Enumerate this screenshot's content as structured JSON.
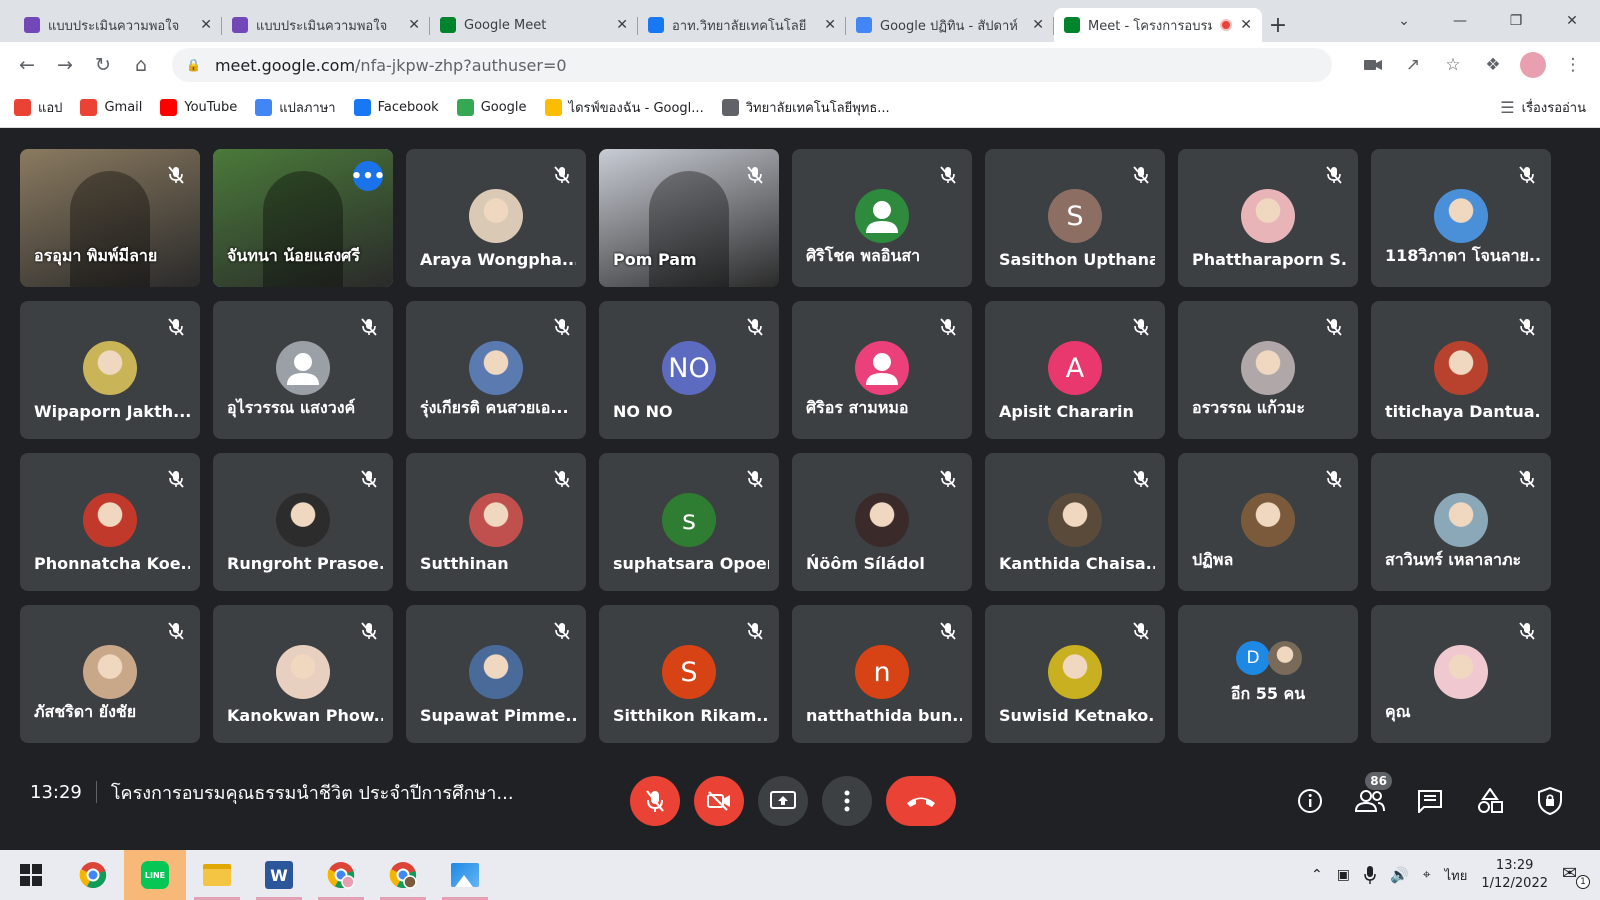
{
  "browser": {
    "tabs": [
      {
        "title": "แบบประเมินความพอใจ",
        "icon": "google-forms-icon",
        "color": "#7248b9"
      },
      {
        "title": "แบบประเมินความพอใจ",
        "icon": "google-forms-icon",
        "color": "#7248b9"
      },
      {
        "title": "Google Meet",
        "icon": "google-meet-icon",
        "color": "#00832d"
      },
      {
        "title": "อาท.วิทยาลัยเทคโนโลยี",
        "icon": "facebook-icon",
        "color": "#1877f2"
      },
      {
        "title": "Google ปฏิทิน - สัปดาห์",
        "icon": "google-calendar-icon",
        "color": "#4285f4"
      },
      {
        "title": "Meet - โครงการอบรม",
        "icon": "google-meet-icon",
        "color": "#00832d"
      }
    ],
    "new_tab": "+",
    "url_host": "meet.google.com",
    "url_path": "/nfa-jkpw-zhp?authuser=0",
    "bookmarks": [
      {
        "label": "แอป",
        "color": "#ea4335"
      },
      {
        "label": "Gmail",
        "color": "#ea4335"
      },
      {
        "label": "YouTube",
        "color": "#ff0000"
      },
      {
        "label": "แปลภาษา",
        "color": "#4285f4"
      },
      {
        "label": "Facebook",
        "color": "#1877f2"
      },
      {
        "label": "Google",
        "color": "#34a853"
      },
      {
        "label": "ไดรฟ์ของฉัน - Googl...",
        "color": "#fbbc04"
      },
      {
        "label": "วิทยาลัยเทคโนโลยีพุทธ...",
        "color": "#5f6368"
      }
    ],
    "reading_list": "เรื่องรออ่าน"
  },
  "meet": {
    "participants": [
      {
        "name": "อรอุมา พิมพ์มีลาย",
        "type": "video",
        "bg": "#8a7a60"
      },
      {
        "name": "จันทนา น้อยแสงศรี",
        "type": "video",
        "bg": "#4a7a3a",
        "speaking": true
      },
      {
        "name": "Araya Wongpha...",
        "type": "photo",
        "bg": "#d9c9b5"
      },
      {
        "name": "Pom Pam",
        "type": "video",
        "bg": "#c8ccd4"
      },
      {
        "name": "ศิริโชค พลอินสา",
        "type": "default",
        "bg": "#2e8b3e"
      },
      {
        "name": "Sasithon Upthana",
        "type": "initial",
        "initial": "S",
        "bg": "#8d6e63"
      },
      {
        "name": "Phattharaporn S...",
        "type": "photo",
        "bg": "#e8b4b8"
      },
      {
        "name": "118วิภาดา โจนลาย...",
        "type": "photo",
        "bg": "#4a90d9"
      },
      {
        "name": "Wipaporn Jakth...",
        "type": "photo",
        "bg": "#c9b458"
      },
      {
        "name": "อุไรวรรณ แสงวงค์",
        "type": "default",
        "bg": "#9aa0a6"
      },
      {
        "name": "รุ่งเกียรติ คนสวยเอ...",
        "type": "photo",
        "bg": "#5a7ab0"
      },
      {
        "name": "NO NO",
        "type": "initial",
        "initial": "NO",
        "bg": "#5c6bc0"
      },
      {
        "name": "ศิริอร สามหมอ",
        "type": "default",
        "bg": "#ec407a"
      },
      {
        "name": "Apisit Chararin",
        "type": "initial",
        "initial": "A",
        "bg": "#e8386e"
      },
      {
        "name": "อรวรรณ แก้วมะ",
        "type": "photo",
        "bg": "#b0a8a8"
      },
      {
        "name": "titichaya Dantua...",
        "type": "photo",
        "bg": "#b8422e"
      },
      {
        "name": "Phonnatcha Koe...",
        "type": "photo",
        "bg": "#c0392b"
      },
      {
        "name": "Rungroht Prasoe...",
        "type": "photo",
        "bg": "#2c2c2c"
      },
      {
        "name": "Sutthinan",
        "type": "photo",
        "bg": "#c0504d"
      },
      {
        "name": "suphatsara Opoer",
        "type": "initial",
        "initial": "s",
        "bg": "#2e7d32"
      },
      {
        "name": "Ńöôm Síládol",
        "type": "photo",
        "bg": "#3a2a2a"
      },
      {
        "name": "Kanthida Chaisa...",
        "type": "photo",
        "bg": "#5a4a3a"
      },
      {
        "name": "ปฏิพล",
        "type": "photo",
        "bg": "#7a5a3a"
      },
      {
        "name": "สาวินทร์ เหลาลาภะ",
        "type": "photo",
        "bg": "#8aa8b8"
      },
      {
        "name": "ภัสชริดา ยังชัย",
        "type": "photo",
        "bg": "#c9a88a"
      },
      {
        "name": "Kanokwan Phow...",
        "type": "photo",
        "bg": "#e8d0c0"
      },
      {
        "name": "Supawat Pimme...",
        "type": "photo",
        "bg": "#4a6a9a"
      },
      {
        "name": "Sitthikon Rikam...",
        "type": "initial",
        "initial": "S",
        "bg": "#d84315"
      },
      {
        "name": "natthathida bun...",
        "type": "initial",
        "initial": "n",
        "bg": "#d84315"
      },
      {
        "name": "Suwisid Ketnako...",
        "type": "photo",
        "bg": "#c9b020"
      },
      {
        "name": "อีก 55 คน",
        "type": "more",
        "initial": "D",
        "bg": "#1e88e5"
      },
      {
        "name": "คุณ",
        "type": "photo",
        "bg": "#f0c8d0"
      }
    ],
    "time": "13:29",
    "meeting_title": "โครงการอบรมคุณธรรมนำชีวิต ประจำปีการศึกษา...",
    "people_count": "86"
  },
  "taskbar": {
    "lang": "ไทย",
    "time": "13:29",
    "date": "1/12/2022",
    "notif": "1"
  }
}
